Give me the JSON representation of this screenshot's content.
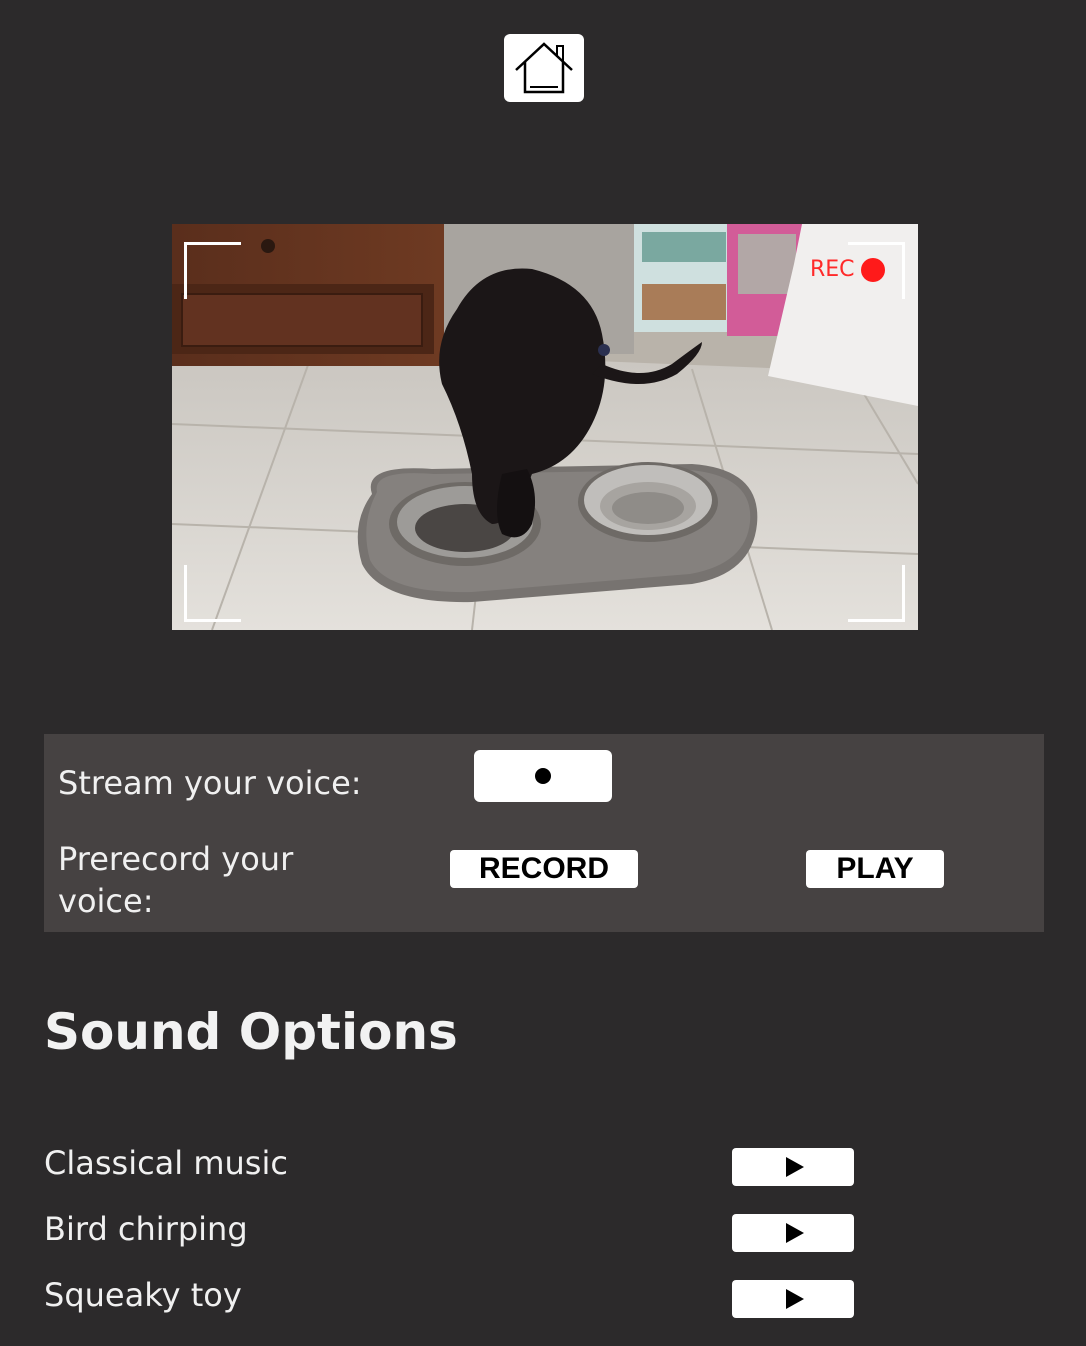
{
  "header": {
    "home_icon": "home-icon"
  },
  "video": {
    "rec_label": "REC",
    "rec_color": "#ff1a1a"
  },
  "voice": {
    "stream_label": "Stream your voice:",
    "stream_button_icon": "dot-icon",
    "prerecord_label": "Prerecord your voice:",
    "record_button": "RECORD",
    "play_button": "PLAY"
  },
  "sound_options": {
    "title": "Sound Options",
    "items": [
      {
        "label": "Classical music",
        "icon": "play-icon"
      },
      {
        "label": "Bird chirping",
        "icon": "play-icon"
      },
      {
        "label": "Squeaky toy",
        "icon": "play-icon"
      }
    ]
  },
  "colors": {
    "background": "#2c2a2b",
    "panel": "#464242",
    "button": "#ffffff",
    "rec": "#ff1a1a"
  }
}
